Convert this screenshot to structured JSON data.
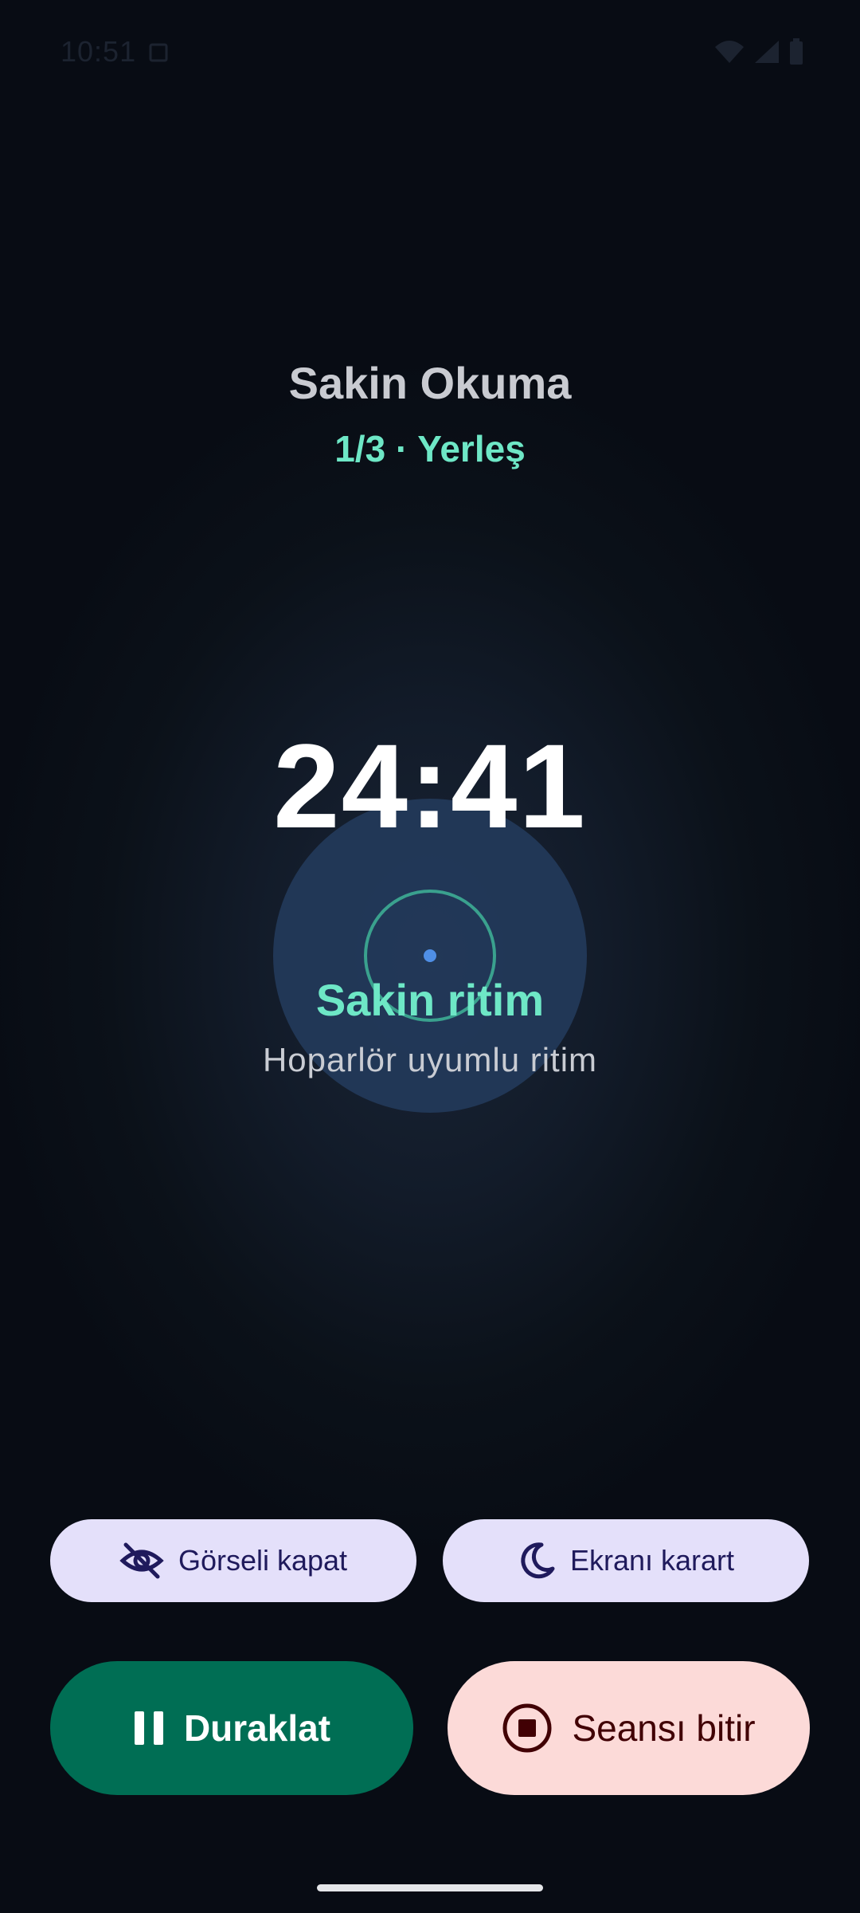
{
  "status_bar": {
    "time": "10:51",
    "icons": [
      "screenshot-icon",
      "wifi-icon",
      "cellular-icon",
      "battery-icon"
    ]
  },
  "session": {
    "title": "Sakin Okuma",
    "subtitle": "1/3 · Yerleş"
  },
  "timer": {
    "remaining": "24:41"
  },
  "rhythm": {
    "title": "Sakin ritim",
    "subtitle": "Hoparlör uyumlu ritim"
  },
  "actions": {
    "hide_visual_label": "Görseli kapat",
    "dim_screen_label": "Ekranı karart",
    "pause_label": "Duraklat",
    "end_session_label": "Seansı bitir"
  },
  "colors": {
    "accent_teal": "#6ee7c6",
    "pause_button": "#006e54",
    "end_button": "#fcdad8",
    "secondary_button": "#e4e0fa",
    "background": "#080c14"
  }
}
